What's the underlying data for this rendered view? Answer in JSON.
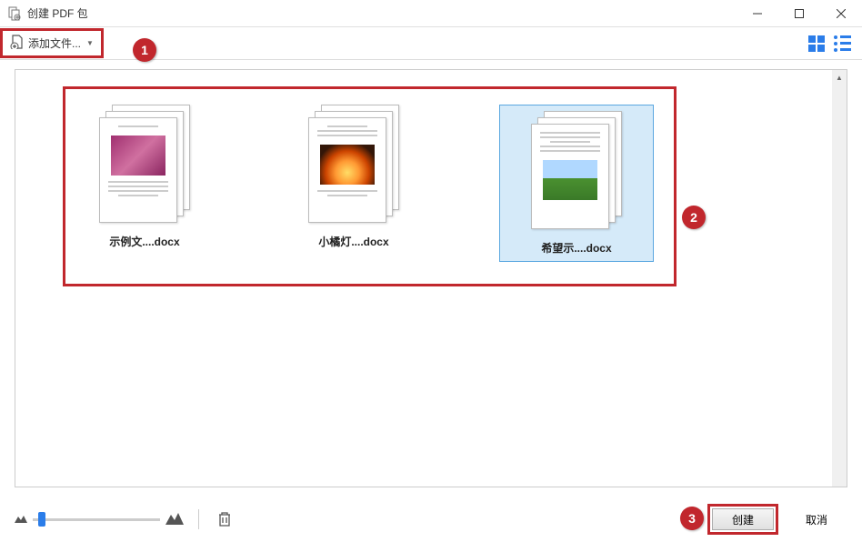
{
  "window": {
    "title": "创建 PDF 包"
  },
  "toolbar": {
    "add_file_label": "添加文件..."
  },
  "files": [
    {
      "label": "示例文....docx",
      "selected": false,
      "thumb": "pink"
    },
    {
      "label": "小橘灯....docx",
      "selected": false,
      "thumb": "fire"
    },
    {
      "label": "希望示....docx",
      "selected": true,
      "thumb": "green"
    }
  ],
  "footer": {
    "create_label": "创建",
    "cancel_label": "取消"
  },
  "callouts": {
    "one": "1",
    "two": "2",
    "three": "3"
  }
}
